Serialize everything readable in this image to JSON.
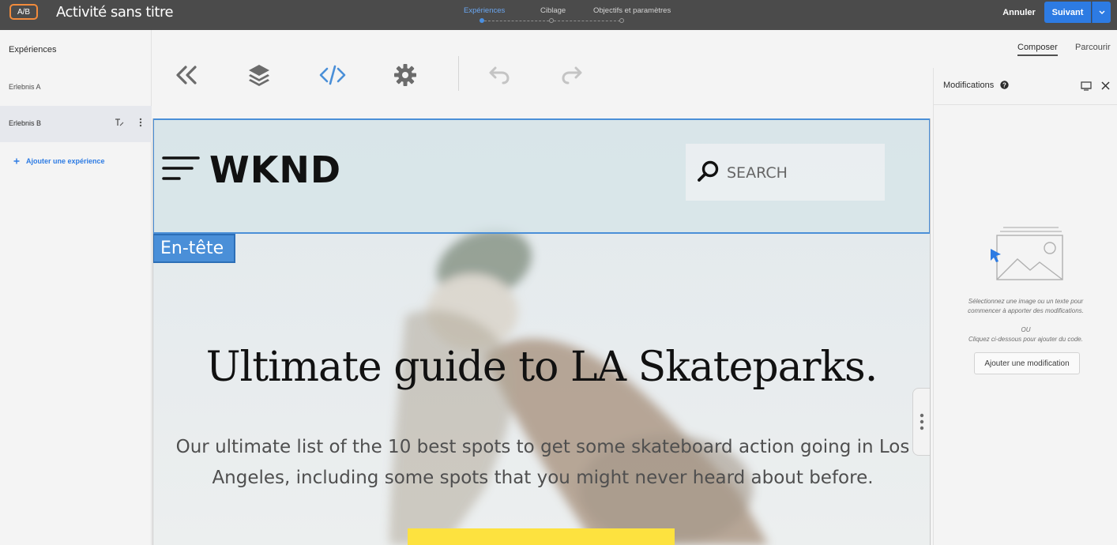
{
  "topbar": {
    "badge": "A/B",
    "title": "Activité sans titre",
    "steps": [
      {
        "label": "Expériences",
        "state": "active"
      },
      {
        "label": "Ciblage",
        "state": "pending"
      },
      {
        "label": "Objectifs et paramètres",
        "state": "pending"
      }
    ],
    "cancel_label": "Annuler",
    "next_label": "Suivant"
  },
  "sidebar": {
    "header": "Expériences",
    "experiences": [
      {
        "label": "Erlebnis A",
        "selected": false
      },
      {
        "label": "Erlebnis B",
        "selected": true
      }
    ],
    "add_label": "Ajouter une expérience"
  },
  "toolbar": {
    "icons": [
      "collapse-left-icon",
      "layers-icon",
      "code-icon",
      "settings-icon",
      "undo-icon",
      "redo-icon"
    ]
  },
  "right_panel": {
    "tabs": [
      {
        "label": "Composer",
        "active": true
      },
      {
        "label": "Parcourir",
        "active": false
      }
    ],
    "modifications_title": "Modifications",
    "hint_line1": "Sélectionnez une image ou un texte pour",
    "hint_line2": "commencer à apporter des modifications.",
    "or_label": "OU",
    "hint_code": "Cliquez ci-dessous pour ajouter du code.",
    "add_mod_label": "Ajouter une modification"
  },
  "canvas": {
    "logo": "WKND",
    "search_placeholder": "SEARCH",
    "selection_label": "En-tête",
    "hero_title": "Ultimate guide to LA Skateparks.",
    "hero_desc_line1": "Our ultimate list of the 10 best spots to get some skateboard action going in Los",
    "hero_desc_line2": "Angeles, including some spots that you might never heard about before."
  },
  "colors": {
    "accent": "#2d7be3",
    "badge_border": "#f28b3c",
    "selection": "#4a8fd8",
    "cta": "#fde23f"
  }
}
